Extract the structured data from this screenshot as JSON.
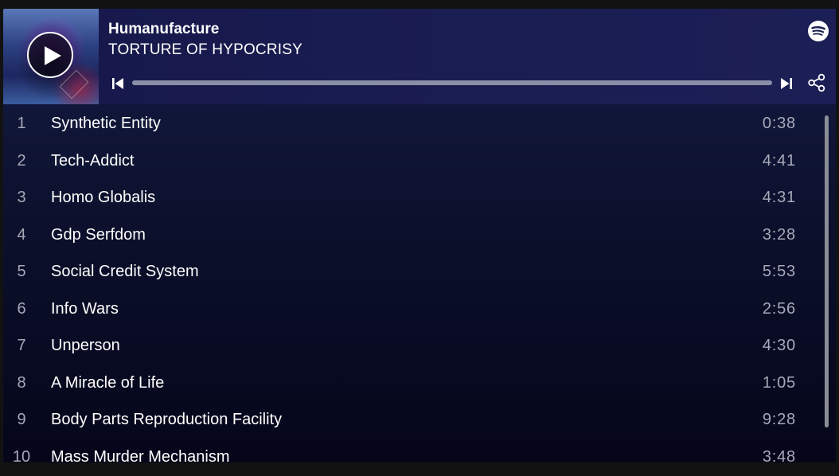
{
  "colors": {
    "page_background": "#121212",
    "header_background": "#1a1d52",
    "tracklist_background": "#0b0f2a",
    "text_primary": "#ffffff",
    "text_secondary": "#a7a9b8",
    "progress_track": "#8a8fa8"
  },
  "header": {
    "artist": "Humanufacture",
    "album": "TORTURE OF HYPOCRISY",
    "cover_icon": "album-cover-art",
    "play_icon": "play-icon",
    "logo_icon": "spotify-logo-icon",
    "prev_icon": "skip-previous-icon",
    "next_icon": "skip-next-icon",
    "share_icon": "share-icon",
    "progress_fraction": 0
  },
  "tracks": [
    {
      "number": "1",
      "title": "Synthetic Entity",
      "duration": "0:38"
    },
    {
      "number": "2",
      "title": "Tech-Addict",
      "duration": "4:41"
    },
    {
      "number": "3",
      "title": "Homo Globalis",
      "duration": "4:31"
    },
    {
      "number": "4",
      "title": "Gdp Serfdom",
      "duration": "3:28"
    },
    {
      "number": "5",
      "title": "Social Credit System",
      "duration": "5:53"
    },
    {
      "number": "6",
      "title": "Info Wars",
      "duration": "2:56"
    },
    {
      "number": "7",
      "title": "Unperson",
      "duration": "4:30"
    },
    {
      "number": "8",
      "title": "A Miracle of Life",
      "duration": "1:05"
    },
    {
      "number": "9",
      "title": "Body Parts Reproduction Facility",
      "duration": "9:28"
    },
    {
      "number": "10",
      "title": "Mass Murder Mechanism",
      "duration": "3:48"
    }
  ]
}
